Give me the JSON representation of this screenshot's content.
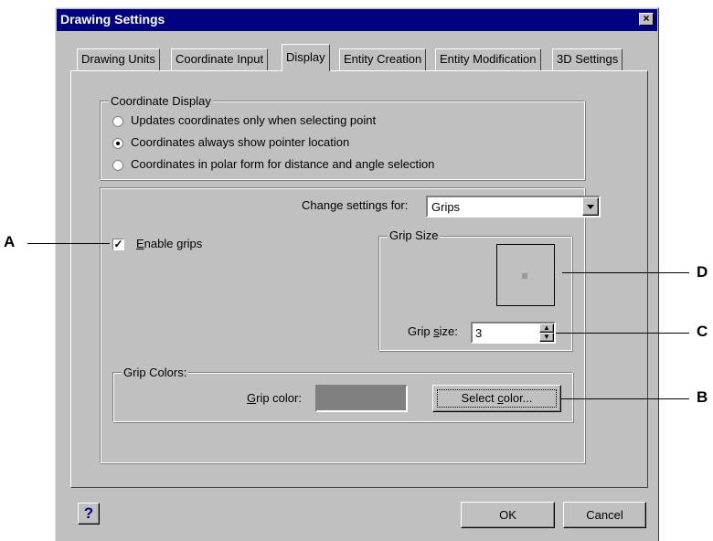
{
  "window": {
    "title": "Drawing Settings",
    "close_glyph": "×"
  },
  "tabs": [
    "Drawing Units",
    "Coordinate Input",
    "Display",
    "Entity Creation",
    "Entity Modification",
    "3D Settings"
  ],
  "coordinate_display": {
    "legend": "Coordinate Display",
    "options": [
      {
        "label": "Updates coordinates only when selecting point",
        "selected": false
      },
      {
        "label": "Coordinates always show pointer location",
        "selected": true
      },
      {
        "label": "Coordinates in polar form for distance and angle selection",
        "selected": false
      }
    ]
  },
  "settings": {
    "change_label": "Change settings for:",
    "change_value": "Grips",
    "enable_grips_label": "Enable grips",
    "enable_grips_checked": true
  },
  "grip_size": {
    "legend": "Grip Size",
    "label": "Grip size:",
    "value": "3"
  },
  "grip_colors": {
    "legend": "Grip Colors:",
    "color_label": "Grip color:",
    "swatch_color": "#808080",
    "select_button": "Select color..."
  },
  "footer": {
    "help": "?",
    "ok": "OK",
    "cancel": "Cancel"
  },
  "callouts": {
    "a": "A",
    "b": "B",
    "c": "C",
    "d": "D"
  }
}
